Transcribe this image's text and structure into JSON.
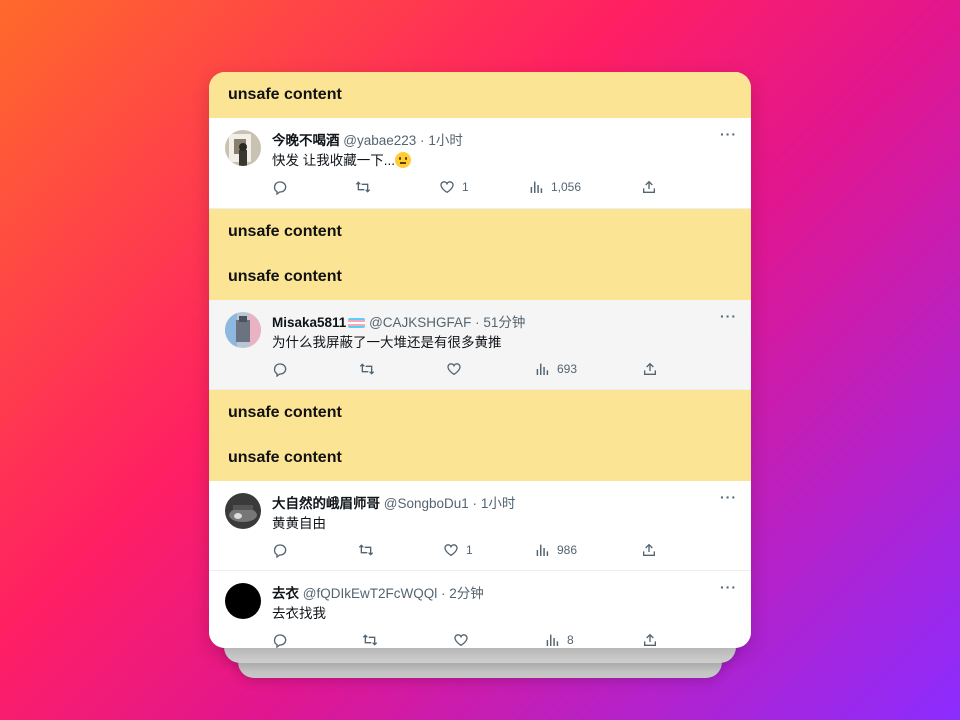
{
  "blocked_label": "unsafe content",
  "tweets": [
    {
      "name": "今晚不喝酒",
      "handle": "@yabae223",
      "time": "1小时",
      "text": "快发 让我收藏一下...",
      "emoji": "neutral-face",
      "likes": "1",
      "views": "1,056"
    },
    {
      "name": "Misaka5811",
      "flag": "transgender-flag",
      "handle": "@CAJKSHGFAF",
      "time": "51分钟",
      "text": "为什么我屏蔽了一大堆还是有很多黄推",
      "likes": "",
      "views": "693"
    },
    {
      "name": "大自然的峨眉师哥",
      "handle": "@SongboDu1",
      "time": "1小时",
      "text": "黄黄自由",
      "likes": "1",
      "views": "986"
    },
    {
      "name": "去衣",
      "handle": "@fQDIkEwT2FcWQQl",
      "time": "2分钟",
      "text": "去衣找我",
      "likes": "",
      "views": "8"
    }
  ],
  "separator": "·",
  "more_label": "···",
  "colors": {
    "blocked_bg": "#fbe494",
    "text_primary": "#0f1419",
    "text_secondary": "#536471"
  }
}
